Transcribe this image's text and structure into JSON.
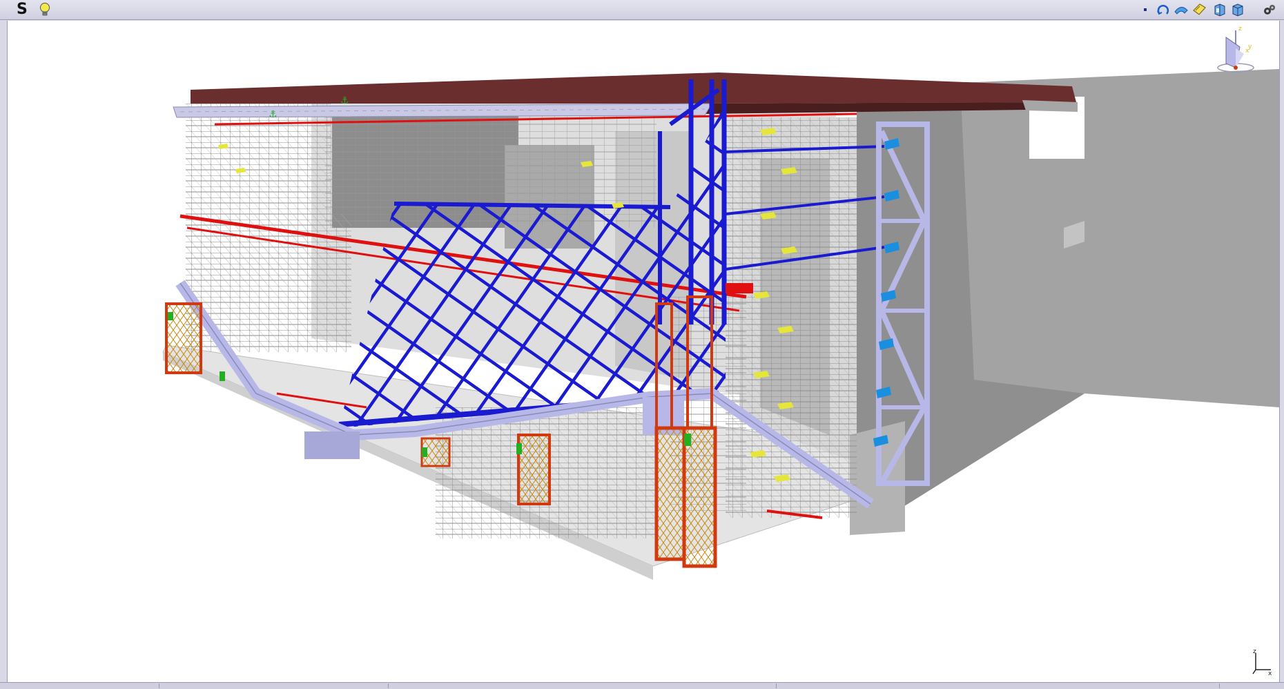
{
  "toolbar": {
    "app_letter": "S",
    "icons": [
      "lightbulb-icon",
      "dot-icon",
      "rotate-icon",
      "fly-icon",
      "pan-icon",
      "view-front-icon",
      "view-iso-icon",
      "settings-icon"
    ]
  },
  "viewport": {
    "background": "#ffffff"
  },
  "model": {
    "colors": {
      "roof": "#6b2e2e",
      "roof_edge": "#c9c9e6",
      "scaffold": "#8c8c8c",
      "steel_lattice": "#1a1ad0",
      "shoring_tower": "#d13a10",
      "red_beams": "#e01010",
      "concrete": "#9b9b9b",
      "concrete_dark": "#7f7f7f",
      "lavender_truss": "#b8b8e8",
      "yellow_tag": "#e6e63a",
      "green_marker": "#22b022",
      "cyan_plate": "#1a8fe0"
    }
  },
  "compass": {
    "label_z": "z",
    "label_x": "x",
    "label_y": "y"
  },
  "axis_triad": {
    "label_z": "z",
    "label_x": "x"
  }
}
